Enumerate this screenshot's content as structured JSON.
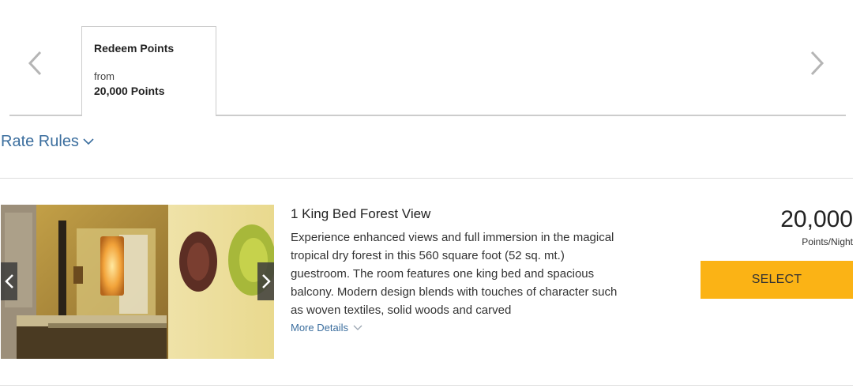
{
  "rate_tabs": {
    "prev_icon": "chevron-left-icon",
    "next_icon": "chevron-right-icon",
    "tabs": [
      {
        "title": "Redeem Points",
        "from_label": "from",
        "points": "20,000 Points",
        "selected": true
      }
    ]
  },
  "rate_rules": {
    "label": "Rate Rules",
    "icon": "chevron-down-icon"
  },
  "room": {
    "name": "1 King Bed Forest View",
    "description": "Experience enhanced views and full immersion in the magical tropical dry forest in this 560 square foot (52 sq. mt.) guestroom. The room features one king bed and spacious balcony. Modern design blends with touches of character such as woven textiles, solid woods and carved",
    "more_details": "More Details",
    "image_prev_icon": "chevron-left-icon",
    "image_next_icon": "chevron-right-icon",
    "price": "20,000",
    "price_unit": "Points/Night",
    "select_label": "SELECT"
  },
  "colors": {
    "link": "#3b6e9e",
    "select_button": "#fbb315",
    "divider": "#dddddd"
  }
}
